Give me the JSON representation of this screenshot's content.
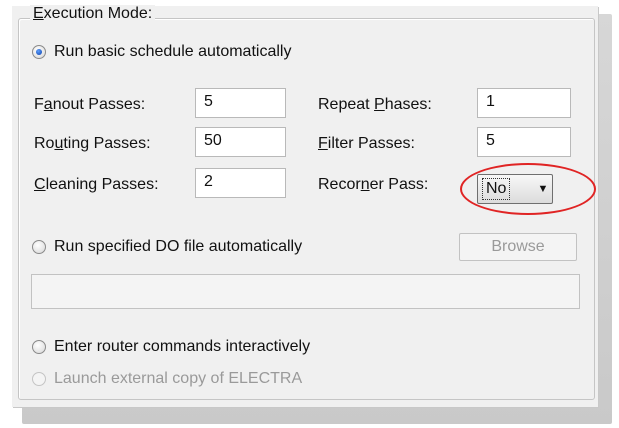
{
  "group": {
    "title": "Execution Mode:"
  },
  "options": {
    "run_basic": "Run basic schedule automatically",
    "run_do": "Run specified DO file automatically",
    "enter_commands": "Enter router commands interactively",
    "launch_electra": "Launch external copy of ELECTRA"
  },
  "fields": {
    "fanout": {
      "label_pre": "F",
      "label_u": "a",
      "label_post": "nout Passes:",
      "value": "5"
    },
    "routing": {
      "label_pre": "Ro",
      "label_u": "u",
      "label_post": "ting Passes:",
      "value": "50"
    },
    "cleaning": {
      "label_pre": "",
      "label_u": "C",
      "label_post": "leaning Passes:",
      "value": "2"
    },
    "repeat": {
      "label_pre": "Repeat ",
      "label_u": "P",
      "label_post": "hases:",
      "value": "1"
    },
    "filter": {
      "label_pre": "",
      "label_u": "F",
      "label_post": "ilter Passes:",
      "value": "5"
    },
    "recorner": {
      "label_pre": "Recor",
      "label_u": "n",
      "label_post": "er Pass:",
      "value": "No"
    }
  },
  "buttons": {
    "browse": "Browse"
  },
  "do_file": {
    "value": ""
  },
  "icons": {
    "dropdown": "chevron-down-icon"
  },
  "colors": {
    "highlight": "#e02424",
    "radio_selected": "#0a3ea8"
  }
}
